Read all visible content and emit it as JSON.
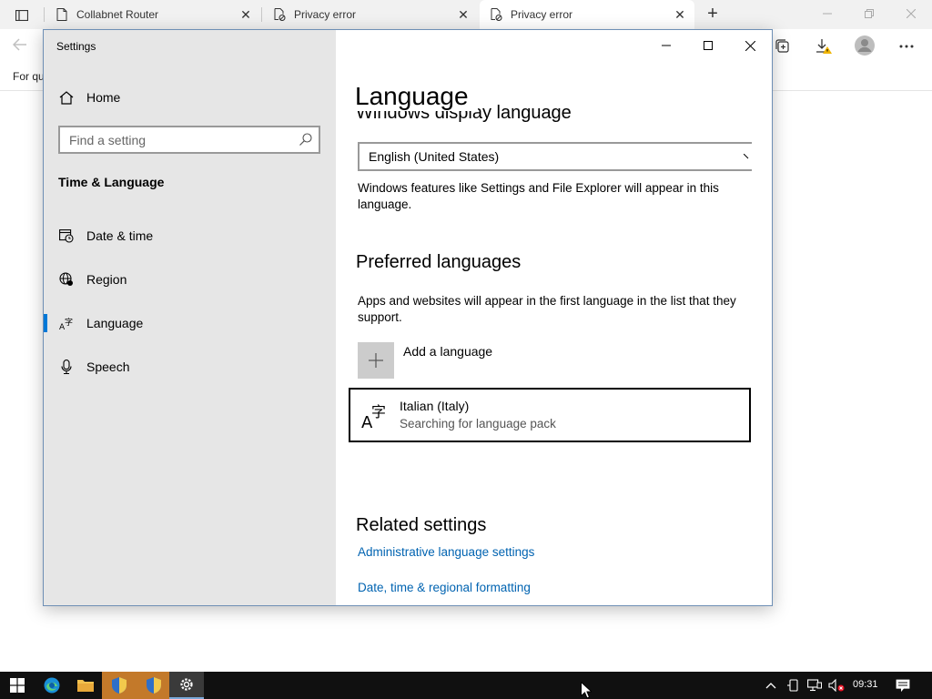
{
  "browser": {
    "tabs": [
      {
        "title": "Collabnet Router",
        "icon": "document-icon"
      },
      {
        "title": "Privacy error",
        "icon": "broken-page-icon"
      },
      {
        "title": "Privacy error",
        "icon": "broken-page-icon"
      }
    ],
    "favorites_text": "For qu"
  },
  "settings": {
    "window_title": "Settings",
    "sidebar": {
      "home_label": "Home",
      "search_placeholder": "Find a setting",
      "section_title": "Time & Language",
      "items": [
        {
          "label": "Date & time",
          "icon": "calendar-clock-icon"
        },
        {
          "label": "Region",
          "icon": "globe-icon"
        },
        {
          "label": "Language",
          "icon": "language-icon",
          "active": true
        },
        {
          "label": "Speech",
          "icon": "microphone-icon"
        }
      ]
    },
    "main": {
      "page_title": "Language",
      "cut_heading": "Windows display language",
      "display_language_value": "English (United States)",
      "display_desc": "Windows features like Settings and File Explorer will appear in this language.",
      "preferred_heading": "Preferred languages",
      "preferred_desc": "Apps and websites will appear in the first language in the list that they support.",
      "add_language_label": "Add a language",
      "language_item": {
        "name": "Italian (Italy)",
        "status": "Searching for language pack"
      },
      "related_heading": "Related settings",
      "links": [
        "Administrative language settings",
        "Date, time & regional formatting"
      ]
    }
  },
  "taskbar": {
    "clock": "09:31",
    "apps": [
      "windows-start-icon",
      "edge-icon",
      "file-explorer-icon",
      "shield-installer-icon",
      "shield-installer-icon",
      "settings-gear-icon"
    ]
  },
  "colors": {
    "accent": "#0078d7",
    "link": "#0063b1",
    "sidebar_bg": "#e6e6e6",
    "taskbar_bg": "#101010"
  }
}
